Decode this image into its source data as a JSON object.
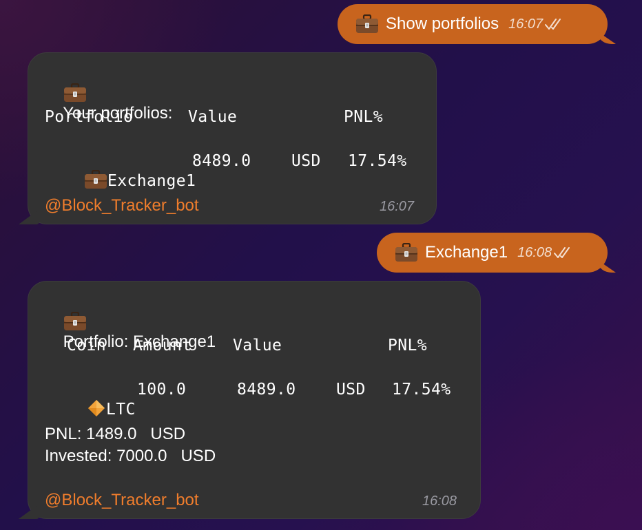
{
  "messages": {
    "out1": {
      "text": "Show portfolios",
      "time": "16:07"
    },
    "in1": {
      "title": "Your portfolios:",
      "headers": [
        "Portfolio",
        "Value",
        "PNL%"
      ],
      "row": {
        "name": "Exchange1",
        "value": "8489.0",
        "currency": "USD",
        "pnl": "17.54%"
      },
      "bot": "@Block_Tracker_bot",
      "time": "16:07"
    },
    "out2": {
      "text": "Exchange1",
      "time": "16:08"
    },
    "in2": {
      "title": "Portfolio: Exchange1",
      "headers": [
        "Coin",
        "Amount",
        "Value",
        "PNL%"
      ],
      "row": {
        "coin": "LTC",
        "amount": "100.0",
        "value": "8489.0",
        "currency": "USD",
        "pnl": "17.54%"
      },
      "pnl_line": "PNL: 1489.0   USD",
      "invested_line": "Invested: 7000.0   USD",
      "bot": "@Block_Tracker_bot",
      "time": "16:08"
    }
  },
  "icons": {
    "briefcase": "briefcase-icon",
    "diamond": "orange-diamond-icon",
    "read": "double-check-icon"
  },
  "colors": {
    "outgoing_bubble": "#c8641e",
    "incoming_bubble": "#323232",
    "link": "#f07d2c"
  }
}
